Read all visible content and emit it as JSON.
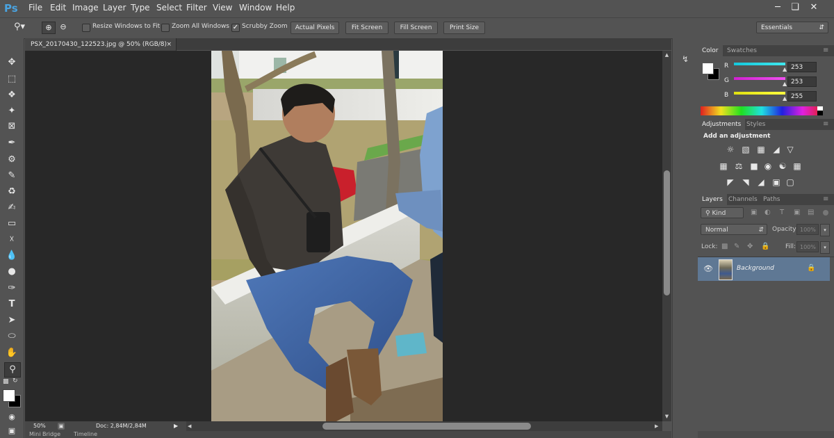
{
  "app": {
    "logo": "Ps"
  },
  "menu": [
    "File",
    "Edit",
    "Image",
    "Layer",
    "Type",
    "Select",
    "Filter",
    "View",
    "Window",
    "Help"
  ],
  "window_controls": [
    "minimize",
    "restore",
    "close"
  ],
  "options": {
    "resize_windows": {
      "label": "Resize Windows to Fit",
      "checked": false
    },
    "zoom_all": {
      "label": "Zoom All Windows",
      "checked": false
    },
    "scrubby_zoom": {
      "label": "Scrubby Zoom",
      "checked": true
    },
    "actual_pixels": "Actual Pixels",
    "fit_screen": "Fit Screen",
    "fill_screen": "Fill Screen",
    "print_size": "Print Size",
    "workspace": "Essentials"
  },
  "document": {
    "tab_title": "PSX_20170430_122523.jpg @ 50% (RGB/8)",
    "zoom": "50%",
    "doc_size": "Doc: 2,84M/2,84M"
  },
  "bottom_tabs": [
    "Mini Bridge",
    "Timeline"
  ],
  "color_panel": {
    "tabs": [
      "Color",
      "Swatches"
    ],
    "r_label": "R",
    "g_label": "G",
    "b_label": "B",
    "r": "253",
    "g": "253",
    "b": "255",
    "r_level": 0.99,
    "g_level": 0.99,
    "b_level": 1.0,
    "colors": {
      "r_track": "#26d6e8",
      "g_track": "#e82de8",
      "b_track": "#f0f020"
    }
  },
  "adjustments_panel": {
    "tabs": [
      "Adjustments",
      "Styles"
    ],
    "heading": "Add an adjustment"
  },
  "layers_panel": {
    "tabs": [
      "Layers",
      "Channels",
      "Paths"
    ],
    "kind": "Kind",
    "blend_mode": "Normal",
    "opacity_label": "Opacity:",
    "opacity": "100%",
    "lock_label": "Lock:",
    "fill_label": "Fill:",
    "fill": "100%",
    "layers": [
      {
        "name": "Background",
        "visible": true,
        "locked": true
      }
    ]
  }
}
